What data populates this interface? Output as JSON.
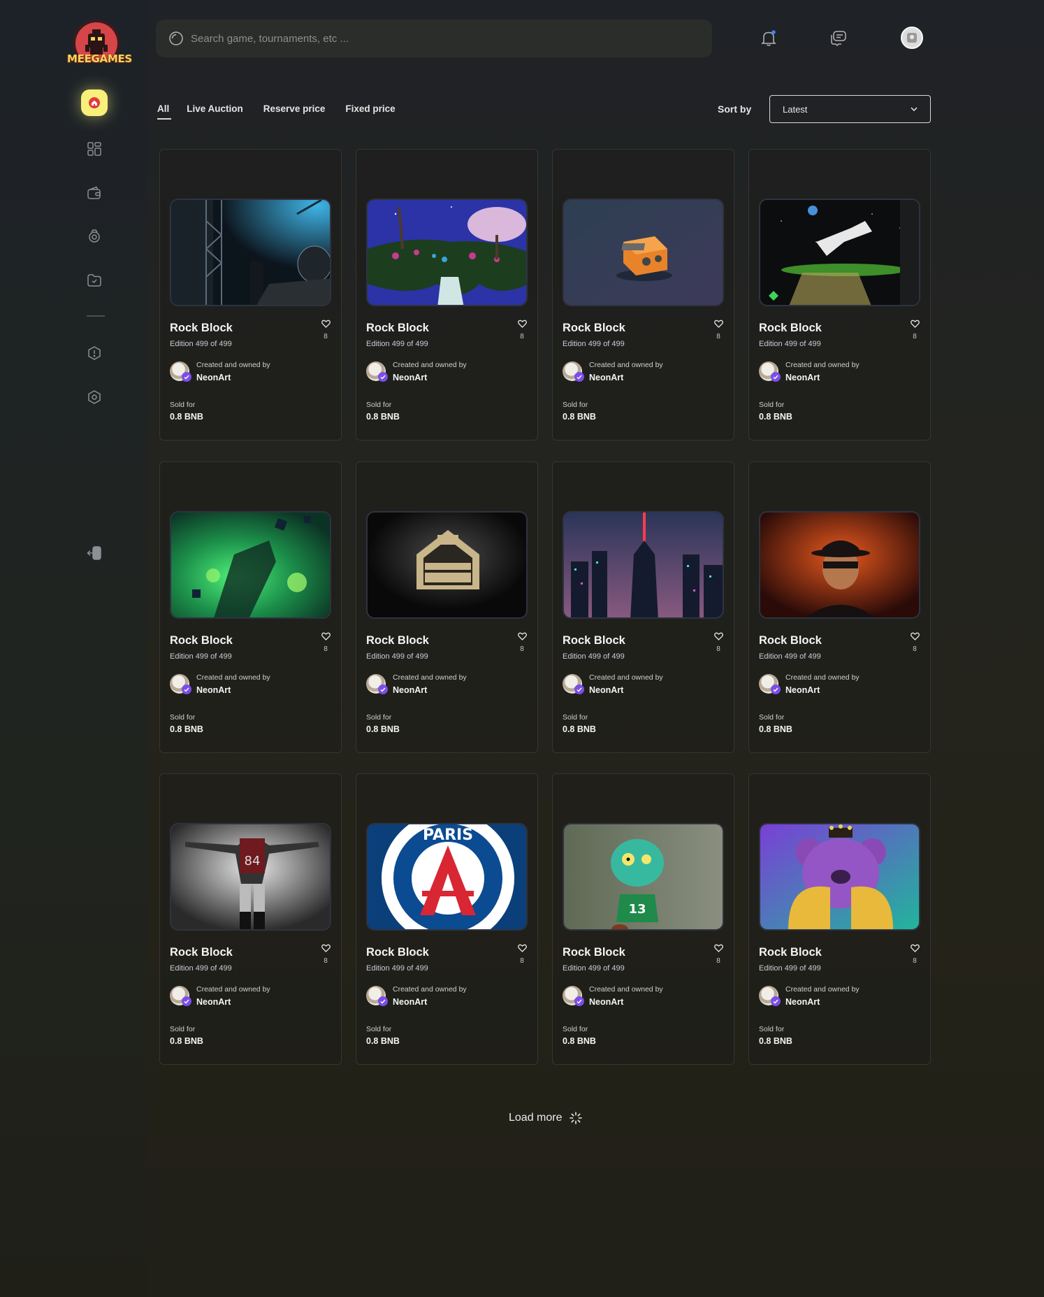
{
  "app": {
    "logo_text": "MEEGAMES"
  },
  "search": {
    "placeholder": "Search game, tournaments, etc ..."
  },
  "tabs": [
    {
      "label": "All"
    },
    {
      "label": "Live Auction"
    },
    {
      "label": "Reserve price"
    },
    {
      "label": "Fixed price"
    }
  ],
  "sort": {
    "label": "Sort by",
    "selected": "Latest"
  },
  "sidebar": {
    "items": [
      {
        "icon": "home-icon"
      },
      {
        "icon": "dashboard-icon"
      },
      {
        "icon": "wallet-icon"
      },
      {
        "icon": "tournament-icon"
      },
      {
        "icon": "folder-icon"
      },
      {
        "icon": "alert-icon"
      },
      {
        "icon": "settings-icon"
      },
      {
        "icon": "logout-icon"
      }
    ]
  },
  "cards": [
    {
      "title": "Rock Block",
      "edition": "Edition 499 of 499",
      "likes": "8",
      "created_label": "Created and owned by",
      "creator": "NeonArt",
      "sold_label": "Sold for",
      "price": "0.8 BNB",
      "image": "concert-stage"
    },
    {
      "title": "Rock Block",
      "edition": "Edition 499 of 499",
      "likes": "8",
      "created_label": "Created and owned by",
      "creator": "NeonArt",
      "sold_label": "Sold for",
      "price": "0.8 BNB",
      "image": "floating-island"
    },
    {
      "title": "Rock Block",
      "edition": "Edition 499 of 499",
      "likes": "8",
      "created_label": "Created and owned by",
      "creator": "NeonArt",
      "sold_label": "Sold for",
      "price": "0.8 BNB",
      "image": "orange-device"
    },
    {
      "title": "Rock Block",
      "edition": "Edition 499 of 499",
      "likes": "8",
      "created_label": "Created and owned by",
      "creator": "NeonArt",
      "sold_label": "Sold for",
      "price": "0.8 BNB",
      "image": "flying-player"
    },
    {
      "title": "Rock Block",
      "edition": "Edition 499 of 499",
      "likes": "8",
      "created_label": "Created and owned by",
      "creator": "NeonArt",
      "sold_label": "Sold for",
      "price": "0.8 BNB",
      "image": "green-explosion"
    },
    {
      "title": "Rock Block",
      "edition": "Edition 499 of 499",
      "likes": "8",
      "created_label": "Created and owned by",
      "creator": "NeonArt",
      "sold_label": "Sold for",
      "price": "0.8 BNB",
      "image": "hall-of-fame"
    },
    {
      "title": "Rock Block",
      "edition": "Edition 499 of 499",
      "likes": "8",
      "created_label": "Created and owned by",
      "creator": "NeonArt",
      "sold_label": "Sold for",
      "price": "0.8 BNB",
      "image": "neon-city"
    },
    {
      "title": "Rock Block",
      "edition": "Edition 499 of 499",
      "likes": "8",
      "created_label": "Created and owned by",
      "creator": "NeonArt",
      "sold_label": "Sold for",
      "price": "0.8 BNB",
      "image": "masked-figure"
    },
    {
      "title": "Rock Block",
      "edition": "Edition 499 of 499",
      "likes": "8",
      "created_label": "Created and owned by",
      "creator": "NeonArt",
      "sold_label": "Sold for",
      "price": "0.8 BNB",
      "image": "football-player"
    },
    {
      "title": "Rock Block",
      "edition": "Edition 499 of 499",
      "likes": "8",
      "created_label": "Created and owned by",
      "creator": "NeonArt",
      "sold_label": "Sold for",
      "price": "0.8 BNB",
      "image": "paris-crest"
    },
    {
      "title": "Rock Block",
      "edition": "Edition 499 of 499",
      "likes": "8",
      "created_label": "Created and owned by",
      "creator": "NeonArt",
      "sold_label": "Sold for",
      "price": "0.8 BNB",
      "image": "zombie-player"
    },
    {
      "title": "Rock Block",
      "edition": "Edition 499 of 499",
      "likes": "8",
      "created_label": "Created and owned by",
      "creator": "NeonArt",
      "sold_label": "Sold for",
      "price": "0.8 BNB",
      "image": "purple-bear"
    }
  ],
  "load_more": {
    "label": "Load more"
  },
  "colors": {
    "accent": "#f8f07a",
    "verified": "#7b4ee8",
    "notification_dot": "#3b82f6"
  }
}
